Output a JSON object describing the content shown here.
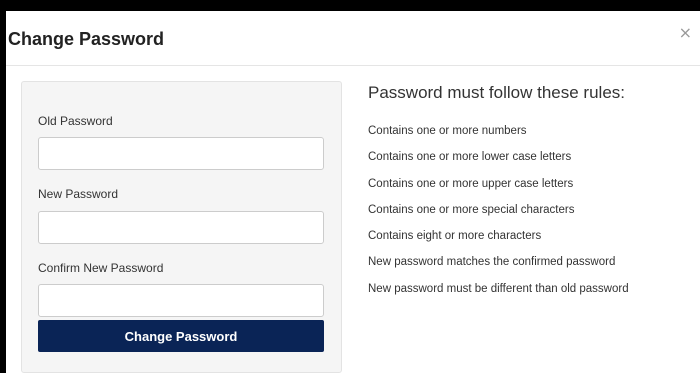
{
  "modal": {
    "title": "Change Password",
    "close_label": "×"
  },
  "form": {
    "old_password": {
      "label": "Old Password",
      "value": ""
    },
    "new_password": {
      "label": "New Password",
      "value": ""
    },
    "confirm_password": {
      "label": "Confirm New Password",
      "value": ""
    },
    "submit_label": "Change Password"
  },
  "rules": {
    "title": "Password must follow these rules:",
    "items": [
      "Contains one or more numbers",
      "Contains one or more lower case letters",
      "Contains one or more upper case letters",
      "Contains one or more special characters",
      "Contains eight or more characters",
      "New password matches the confirmed password",
      "New password must be different than old password"
    ]
  },
  "colors": {
    "primary_button": "#0a2456",
    "panel_background": "#f5f5f5",
    "backdrop": "#000000"
  }
}
